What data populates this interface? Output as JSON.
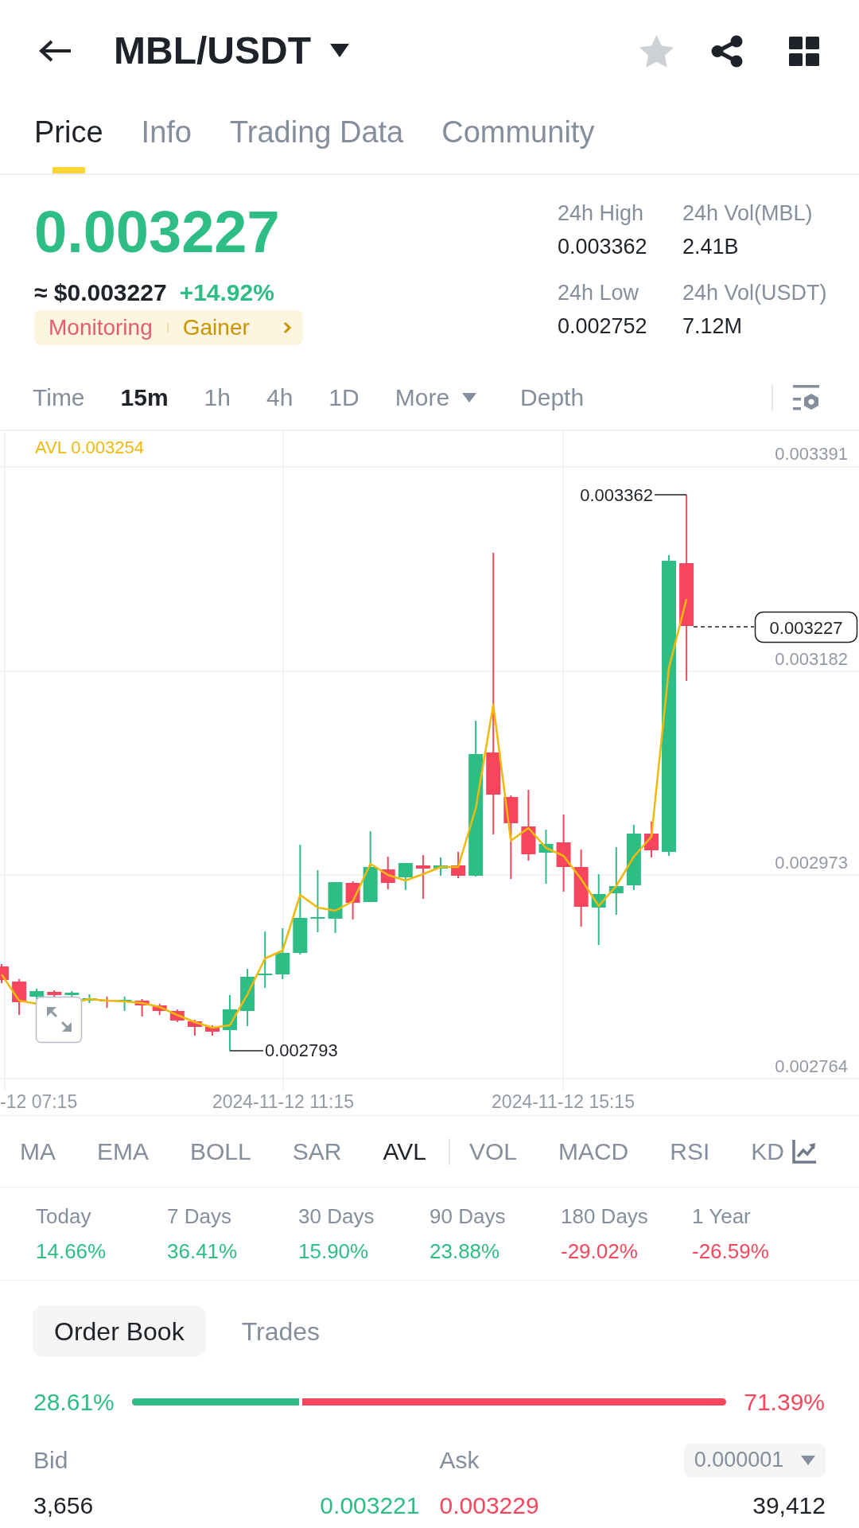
{
  "header": {
    "title": "MBL/USDT",
    "favorited": false
  },
  "tabs": [
    {
      "label": "Price",
      "selected": true
    },
    {
      "label": "Info",
      "selected": false
    },
    {
      "label": "Trading Data",
      "selected": false
    },
    {
      "label": "Community",
      "selected": false
    }
  ],
  "ticker": {
    "last_price": "0.003227",
    "usd_price": "≈ $0.003227",
    "change": "+14.92%",
    "negative": false,
    "tags": [
      {
        "label": "Monitoring",
        "kind": "monitoring"
      },
      {
        "label": "Gainer",
        "kind": "gainer"
      }
    ]
  },
  "stats": [
    {
      "label": "24h High",
      "value": "0.003362"
    },
    {
      "label": "24h Vol(MBL)",
      "value": "2.41B"
    },
    {
      "label": "24h Low",
      "value": "0.002752"
    },
    {
      "label": "24h Vol(USDT)",
      "value": "7.12M"
    }
  ],
  "intervals": [
    {
      "label": "Time",
      "selected": false,
      "kind": "option"
    },
    {
      "label": "15m",
      "selected": true,
      "kind": "option"
    },
    {
      "label": "1h",
      "selected": false,
      "kind": "option"
    },
    {
      "label": "4h",
      "selected": false,
      "kind": "option"
    },
    {
      "label": "1D",
      "selected": false,
      "kind": "option"
    },
    {
      "label": "More",
      "selected": false,
      "kind": "dropdown"
    },
    {
      "label": "Depth",
      "selected": false,
      "kind": "option"
    }
  ],
  "chart": {
    "indicator_label": "AVL 0.003254",
    "price_labels": [
      "0.003391",
      "0.003182",
      "0.002973",
      "0.002764"
    ],
    "time_labels": [
      "-12 07:15",
      "2024-11-12 11:15",
      "2024-11-12 15:15"
    ],
    "high_label": "0.003362",
    "low_label": "0.002793",
    "last_price_tag": "0.003227"
  },
  "indicators": {
    "overlays": [
      {
        "label": "MA",
        "selected": false
      },
      {
        "label": "EMA",
        "selected": false
      },
      {
        "label": "BOLL",
        "selected": false
      },
      {
        "label": "SAR",
        "selected": false
      },
      {
        "label": "AVL",
        "selected": true
      }
    ],
    "sub": [
      {
        "label": "VOL",
        "selected": false
      },
      {
        "label": "MACD",
        "selected": false
      },
      {
        "label": "RSI",
        "selected": false
      },
      {
        "label": "KD",
        "selected": false
      }
    ]
  },
  "performance": [
    {
      "period": "Today",
      "change": "14.66%",
      "negative": false
    },
    {
      "period": "7 Days",
      "change": "36.41%",
      "negative": false
    },
    {
      "period": "30 Days",
      "change": "15.90%",
      "negative": false
    },
    {
      "period": "90 Days",
      "change": "23.88%",
      "negative": false
    },
    {
      "period": "180 Days",
      "change": "-29.02%",
      "negative": true
    },
    {
      "period": "1 Year",
      "change": "-26.59%",
      "negative": true
    }
  ],
  "order_book": {
    "tabs": [
      {
        "label": "Order Book",
        "selected": true
      },
      {
        "label": "Trades",
        "selected": false
      }
    ],
    "bid_share": "28.61%",
    "ask_share": "71.39%",
    "level": 0.2861,
    "bid_header": "Bid",
    "ask_header": "Ask",
    "precision": "0.000001",
    "rows": [
      {
        "bid_amount": "3,656",
        "bid_price": "0.003221",
        "ask_price": "0.003229",
        "ask_amount": "39,412"
      }
    ]
  }
}
